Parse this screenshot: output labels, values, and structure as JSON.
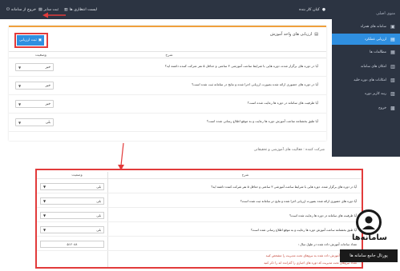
{
  "topbar": {
    "user_name": "کیان کار بنده",
    "link_logout": "خروج از سامانه",
    "link_report": "لیست انتظاری ها",
    "link_lists": "ثبت سایر"
  },
  "sidebar": {
    "heading": "منوی اصلی",
    "items": [
      {
        "label": "سامانه های همراه",
        "icon": "▣"
      },
      {
        "label": "ارزیابی عملکرد",
        "icon": "▤"
      },
      {
        "label": "مطالعات ها",
        "icon": "▦"
      },
      {
        "label": "امکان های سامانه",
        "icon": "▥"
      },
      {
        "label": "امکانات های دوره خلیه",
        "icon": "▧"
      },
      {
        "label": "رتبه کاربر دوره",
        "icon": "▨"
      },
      {
        "label": "خروج",
        "icon": "▩"
      }
    ]
  },
  "panel": {
    "title": "ارزیابی های واحد آموزش",
    "report_button": "ثبت ارزیابی",
    "col_question": "شرح",
    "col_status": "وضعیت",
    "rows": [
      {
        "question": "آیا در دوره های برگزار شده، دوره هایی با شرایط ساعت آموزشی ۳ ساعتی و حداقل ۵ نفر شرکت کننده داشته اید؟",
        "value": "خیر"
      },
      {
        "question": "آیا در دوره های حضوری ارائه شده بصورت ارزیابی اجرا شده و نتایج در سامانه ثبت شده است؟",
        "value": "خیر"
      },
      {
        "question": "آیا ظرفیت های سامانه در دوره ها رعایت شده است؟",
        "value": "خیر"
      },
      {
        "question": "آیا طبق بخشنامه ساعت آموزش دوره ها رعایت و به موقع اطلاع رسانی شده است؟",
        "value": "بلی"
      }
    ]
  },
  "subtitle": "شرکت کننده : فعالیت های آموزشی و تحقیقاتی",
  "zoom": {
    "col_question": "شرح",
    "col_status": "وضعیت",
    "rows": [
      {
        "question": "آیا در دوره های برگزار شده، دوره هایی با شرایط ساعت آموزشی ۳ ساعتی و حداقل ۵ نفر شرکت کننده داشته اید؟",
        "value": "بلی"
      },
      {
        "question": "آیا دوره های حضوری ارائه شده بصورت ارزیابی اجرا شده و نتایج در سامانه ثبت شده است؟",
        "value": "بلی"
      },
      {
        "question": "آیا ظرفیت های سامانه در دوره ها رعایت شده است؟",
        "value": "بلی"
      },
      {
        "question": "آیا طبق بخشنامه ساعت آموزش دوره ها رعایت و به موقع اطلاع رسانی شده است؟",
        "value": "بلی"
      }
    ],
    "number_value": "۵۱۲۰۸۸",
    "number_label": "تعداد ساعات آموزش داده شده در طول سال :",
    "note_1": "تعداد ساعات آموزش داده شده به نیروهای تحت مدیریت را مشخص کنید",
    "note_2": "تعداد نیروهای تحت مدیریت که دوره های اجباری را گذرانده اند را ذکر کنید"
  },
  "watermark": {
    "name": "ساماﻧﻪها",
    "subtitle": "پورتال جامع سامانه ها"
  },
  "colors": {
    "sidebar_bg": "#2c3442",
    "active_item": "#2f8fe0",
    "accent_border": "#f0a03c",
    "highlight_red": "#e23b3b"
  }
}
